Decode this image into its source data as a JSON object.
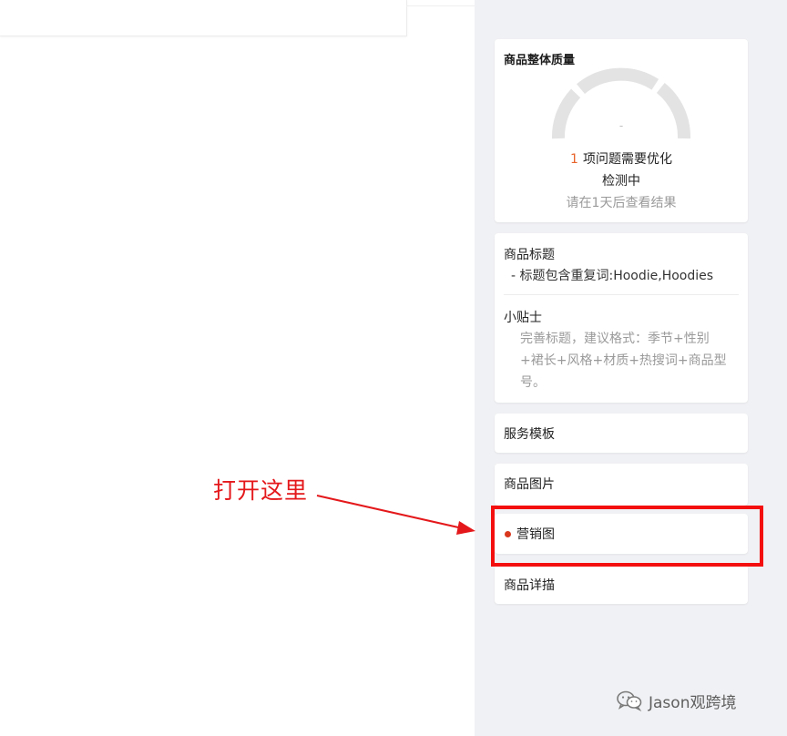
{
  "quality": {
    "title": "商品整体质量",
    "score_placeholder": "-",
    "issue_count": "1",
    "issue_text": "项问题需要优化",
    "status": "检测中",
    "hint": "请在1天后查看结果"
  },
  "title_section": {
    "heading": "商品标题",
    "issue": "- 标题包含重复词:Hoodie,Hoodies",
    "tips_heading": "小贴士",
    "tips_text": "完善标题，建议格式：季节+性别+裙长+风格+材质+热搜词+商品型号。"
  },
  "sections": {
    "service_template": "服务模板",
    "product_images": "商品图片",
    "marketing_image": "营销图",
    "product_details": "商品详描"
  },
  "annotation": {
    "text": "打开这里"
  },
  "watermark": {
    "text": "Jason观跨境"
  },
  "colors": {
    "accent_orange": "#e8642c",
    "status_dot": "#d9381e",
    "annotation_red": "#f40f0f"
  },
  "icons": {
    "watermark": "wechat-icon"
  }
}
